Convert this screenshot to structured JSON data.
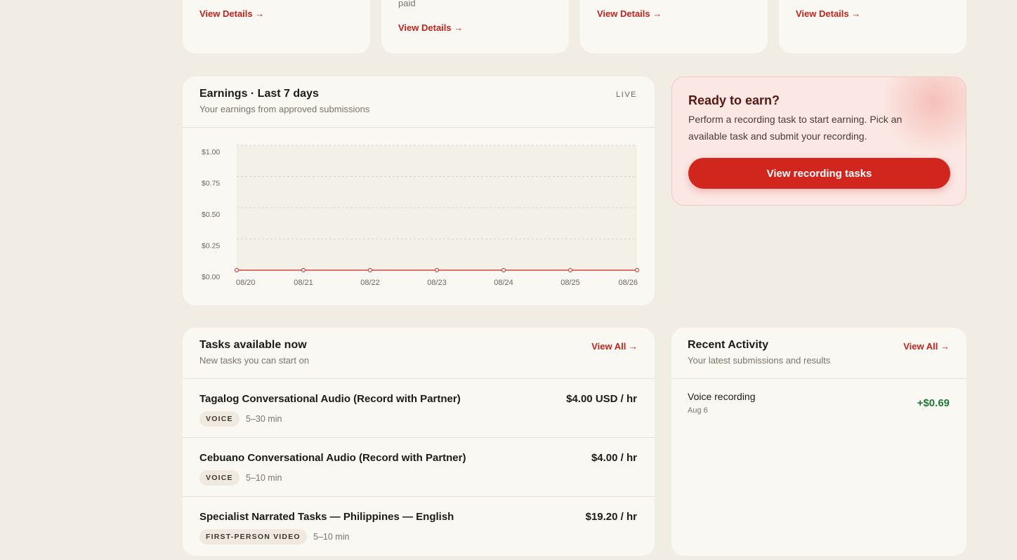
{
  "top_cards": [
    {
      "link": "View Details →"
    },
    {
      "note": "paid",
      "link": "View Details →"
    },
    {
      "link": "View Details →"
    },
    {
      "link": "View Details →"
    }
  ],
  "earnings": {
    "title": "Earnings · Last 7 days",
    "subtitle": "Your earnings from approved submissions",
    "live": "LIVE"
  },
  "chart_data": {
    "type": "line",
    "title": "Earnings · Last 7 days",
    "x": [
      "08/20",
      "08/21",
      "08/22",
      "08/23",
      "08/24",
      "08/25",
      "08/26"
    ],
    "y_ticks": [
      "$1.00",
      "$0.75",
      "$0.50",
      "$0.25",
      "$0.00"
    ],
    "ylim": [
      0,
      1
    ],
    "series": [
      {
        "values": [
          0,
          0,
          0,
          0,
          0,
          0,
          0
        ]
      }
    ],
    "grid": true,
    "line_color": "#d1261e"
  },
  "ready": {
    "title": "Ready to earn?",
    "body": "Perform a recording task to start earning. Pick an available task and submit your recording.",
    "button": "View recording tasks"
  },
  "tasks": {
    "title": "Tasks available now",
    "subtitle": "New tasks you can start on",
    "view_all": "View All →",
    "items": [
      {
        "title": "Tagalog Conversational Audio (Record with Partner)",
        "pay": "$4.00 USD / hr",
        "badge": "VOICE",
        "duration": "5–30 min"
      },
      {
        "title": "Cebuano Conversational Audio (Record with Partner)",
        "pay": "$4.00 / hr",
        "badge": "VOICE",
        "duration": "5–10 min"
      },
      {
        "title": "Specialist Narrated Tasks — Philippines — English",
        "pay": "$19.20 / hr",
        "badge": "FIRST-PERSON VIDEO",
        "duration": "5–10 min"
      }
    ]
  },
  "activity": {
    "title": "Recent Activity",
    "subtitle": "Your latest submissions and results",
    "view_all": "View All →",
    "items": [
      {
        "title": "Voice recording",
        "date": "Aug 6",
        "amount": "+$0.69"
      }
    ]
  },
  "colors": {
    "accent": "#d1261e",
    "positive": "#1f7a38",
    "background": "#f1ede5",
    "card": "#faf8f3"
  }
}
